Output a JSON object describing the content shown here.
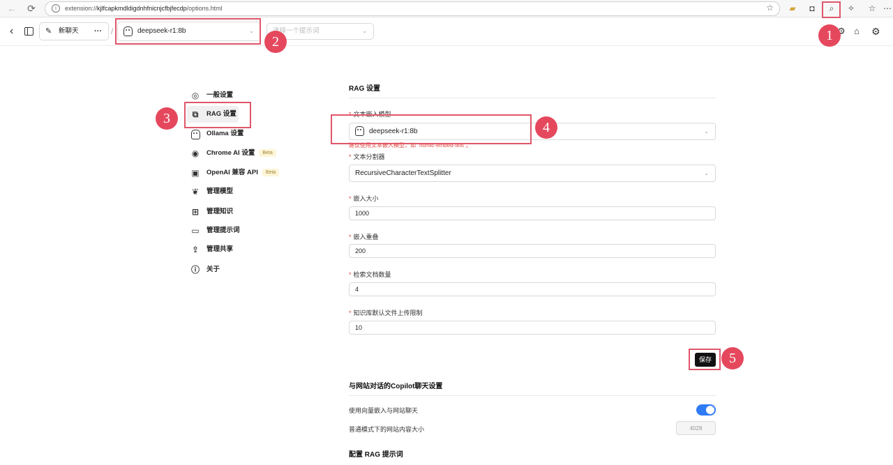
{
  "browser": {
    "url_prefix": "extension://",
    "url_host": "kjlfcapkmdldigdnhfnicnjcfbjfecdp",
    "url_path": "/options.html"
  },
  "header": {
    "new_chat_label": "新聊天",
    "more_label": "···",
    "separator": "/",
    "model_select_value": "deepseek-r1:8b",
    "prompt_select_placeholder": "选择一个提示词"
  },
  "sidebar": {
    "items": [
      {
        "label": "一般设置",
        "icon": "gear-circle-icon"
      },
      {
        "label": "RAG 设置",
        "icon": "rag-icon"
      },
      {
        "label": "Ollama 设置",
        "icon": "ollama-icon"
      },
      {
        "label": "Chrome AI 设置",
        "icon": "chrome-icon",
        "badge": "Beta"
      },
      {
        "label": "OpenAI 兼容 API",
        "icon": "cpu-icon",
        "badge": "Beta"
      },
      {
        "label": "管理模型",
        "icon": "brain-icon"
      },
      {
        "label": "管理知识",
        "icon": "blocks-icon"
      },
      {
        "label": "管理提示词",
        "icon": "book-icon"
      },
      {
        "label": "管理共享",
        "icon": "share-icon"
      },
      {
        "label": "关于",
        "icon": "info-icon"
      }
    ]
  },
  "rag": {
    "title": "RAG 设置",
    "embedding_label": "文本嵌入模型",
    "embedding_value": "deepseek-r1:8b",
    "embedding_hint": "建议使用文本嵌入模型，如 \"nomic-embed-text\"。",
    "splitter_label": "文本分割器",
    "splitter_value": "RecursiveCharacterTextSplitter",
    "chunk_size_label": "嵌入大小",
    "chunk_size_value": "1000",
    "chunk_overlap_label": "嵌入重叠",
    "chunk_overlap_value": "200",
    "retrieval_count_label": "检索文档数量",
    "retrieval_count_value": "4",
    "upload_limit_label": "知识库默认文件上传限制",
    "upload_limit_value": "10",
    "save_label": "保存"
  },
  "copilot": {
    "title": "与网站对话的Copilot聊天设置",
    "vector_label": "使用向量嵌入与网站聊天",
    "vector_enabled": true,
    "normal_mode_label": "普通模式下的网站内容大小",
    "normal_mode_value": "4028"
  },
  "rag_prompt": {
    "title": "配置 RAG 提示词"
  },
  "annotations": [
    "1",
    "2",
    "3",
    "4",
    "5"
  ],
  "colors": {
    "annotation_red": "#e5485d",
    "toggle_blue": "#2f7cf6",
    "required_red": "#e0463c"
  }
}
